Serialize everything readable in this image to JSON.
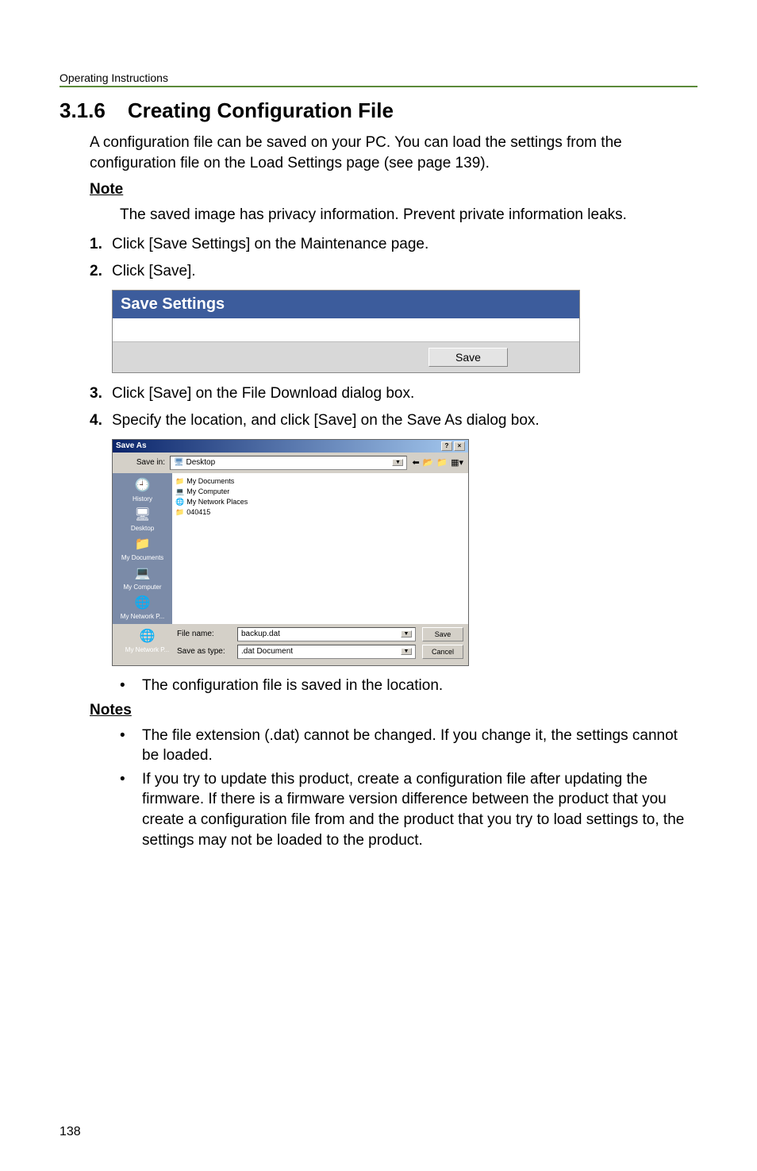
{
  "header": "Operating Instructions",
  "section": {
    "number": "3.1.6",
    "title": "Creating Configuration File"
  },
  "intro": "A configuration file can be saved on your PC. You can load the settings from the configuration file on the Load Settings page (see page 139).",
  "note_heading": "Note",
  "note_text": "The saved image has privacy information. Prevent private information leaks.",
  "steps": {
    "s1_num": "1.",
    "s1_text": "Click [Save Settings] on the Maintenance page.",
    "s2_num": "2.",
    "s2_text": "Click [Save].",
    "s3_num": "3.",
    "s3_text": "Click [Save] on the File Download dialog box.",
    "s4_num": "4.",
    "s4_text": "Specify the location, and click [Save] on the Save As dialog box."
  },
  "save_settings_panel": {
    "title": "Save Settings",
    "button": "Save"
  },
  "save_as": {
    "title": "Save As",
    "help_btn": "?",
    "close_btn": "×",
    "save_in_label": "Save in:",
    "save_in_value": "Desktop",
    "nav_back": "⬅",
    "nav_up": "📂",
    "nav_new": "📁",
    "nav_view": "▦▾",
    "sidebar": {
      "history": "History",
      "desktop": "Desktop",
      "mydocs": "My Documents",
      "mycomp": "My Computer",
      "mynet": "My Network P..."
    },
    "filelist": {
      "f1": "My Documents",
      "f2": "My Computer",
      "f3": "My Network Places",
      "f4": "040415"
    },
    "filename_label": "File name:",
    "filename_value": "backup.dat",
    "saveastype_label": "Save as type:",
    "saveastype_value": ".dat Document",
    "save_btn": "Save",
    "cancel_btn": "Cancel"
  },
  "bullet_saved": "The configuration file is saved in the location.",
  "notes_heading": "Notes",
  "notes": {
    "n1": "The file extension (.dat) cannot be changed. If you change it, the settings cannot be loaded.",
    "n2": "If you try to update this product, create a configuration file after updating the firmware. If there is a firmware version difference between the product that you create a configuration file from and the product that you try to load settings to, the settings may not be loaded to the product."
  },
  "page_number": "138"
}
